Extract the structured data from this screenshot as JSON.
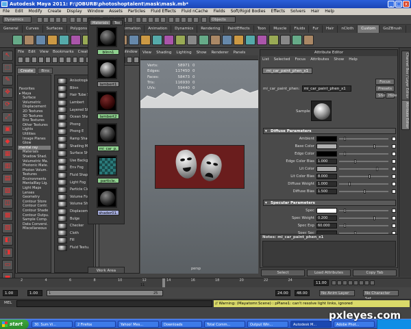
{
  "window": {
    "title": "Autodesk Maya 2011: F:\\JOBURB\\photoshoptalent\\mask\\mask.mb*",
    "min": "_",
    "max": "□",
    "close": "x"
  },
  "menubar": [
    "File",
    "Edit",
    "Modify",
    "Create",
    "Display",
    "Window",
    "Assets",
    "Particles",
    "Fluid Effects",
    "Fluid nCache",
    "Fields",
    "Soft/Rigid Bodies",
    "Effects",
    "Solvers",
    "Hair",
    "Help"
  ],
  "statusline": {
    "mode": "Dynamics",
    "search": "Objects"
  },
  "shelf_tabs": [
    "General",
    "Curves",
    "Surfaces",
    "Polygons",
    "Subdivs",
    "Deformation",
    "Animation",
    "Dynamics",
    "Rendering",
    "PaintEffects",
    "Toon",
    "Muscle",
    "Fluids",
    "Fur",
    "Hair",
    "nCloth",
    "Custom",
    "GoZBrush"
  ],
  "shelf_active": "Custom",
  "hypershade": {
    "menu": [
      "File",
      "Edit",
      "View",
      "Bookmarks",
      "Create",
      "Tabs",
      "Graph",
      "Window"
    ],
    "create_tabs": [
      "Create",
      "Bins"
    ],
    "tree": [
      "Favorites",
      "▸ Maya",
      "Surface",
      "Volumetric",
      "Displacement",
      "2D Textures",
      "3D Textures",
      "Env Textures",
      "Other Textures",
      "Lights",
      "Utilities",
      "Image Planes",
      "Glow",
      "mental ray",
      "Materials",
      "Shadow Shad.",
      "Volumetric Ma.",
      "Photonic Mate.",
      "Photon Volum.",
      "Textures",
      "Environments",
      "MentalRay Lig.",
      "Light Maps",
      "Lenses",
      "Geometry",
      "Contour Store",
      "Contour Contr.",
      "Contour Shade",
      "Contour Outpu.",
      "Sample Comp.",
      "Data Conversi.",
      "Miscellaneous"
    ],
    "tree_selected": "mental ray",
    "nodes": [
      "Anisotropic",
      "Blinn",
      "Hair Tube S.",
      "Lambert",
      "Layered Sha.",
      "Ocean Shad.",
      "Phong",
      "Phong E",
      "Ramp Shad.",
      "Shading Ma.",
      "Surface Sh.",
      "Use Backgr.",
      "Env Fog",
      "Fluid Shap.",
      "Light Fog",
      "Particle Clo.",
      "Volume Fog",
      "Volume Sha.",
      "Displaceme.",
      "Bulge",
      "Checker",
      "Cloth",
      "Fill",
      "Fluid Textu."
    ],
    "material_tabs": [
      "Materials",
      "Tex"
    ],
    "swatches": [
      {
        "label": "blinn1",
        "kind": "dark"
      },
      {
        "label": "lambert1",
        "kind": "gray"
      },
      {
        "label": "lambert2",
        "kind": "red"
      },
      {
        "label": "mi_car_p.",
        "kind": "dark"
      },
      {
        "label": "particle.",
        "kind": "check"
      },
      {
        "label": "shader01.",
        "kind": "dark"
      }
    ],
    "work_area": "Work Area"
  },
  "viewport": {
    "menu": [
      "View",
      "Shading",
      "Lighting",
      "Show",
      "Renderer",
      "Panels"
    ],
    "hud_labels": [
      "Verts:",
      "Edges:",
      "Faces:",
      "Tris:",
      "UVs:"
    ],
    "hud_values": [
      "58971",
      "117450",
      "58473",
      "116930",
      "59440"
    ],
    "hud_values2": [
      "0",
      "0",
      "0",
      "0",
      "0"
    ],
    "camera": "persp"
  },
  "attribute_editor": {
    "title": "Attribute Editor",
    "menu": [
      "List",
      "Selected",
      "Focus",
      "Attributes",
      "Show",
      "Help"
    ],
    "node_tab": "mi_car_paint_phen_x1",
    "node_label": "mi_car_paint_phen:",
    "node_name": "mi_car_paint_phen_x1",
    "buttons": [
      "Focus",
      "Presets",
      "Show",
      "Hide"
    ],
    "sample_label": "Sample",
    "sections": [
      {
        "title": "Diffuse Parameters",
        "rows": [
          {
            "label": "Ambient",
            "type": "color",
            "color": "#000000"
          },
          {
            "label": "Base Color",
            "type": "color",
            "color": "#b0b0b0"
          },
          {
            "label": "Edge Color",
            "type": "color",
            "color": "#000000"
          },
          {
            "label": "Edge Color Bias",
            "type": "value",
            "value": "1.000"
          },
          {
            "label": "Lit Color",
            "type": "color",
            "color": "#a8a8a8"
          },
          {
            "label": "Lit Color Bias",
            "type": "value",
            "value": "8.000"
          },
          {
            "label": "Diffuse Weight",
            "type": "value",
            "value": "1.000"
          },
          {
            "label": "Diffuse Bias",
            "type": "value",
            "value": "1.500"
          }
        ]
      },
      {
        "title": "Specular Parameters",
        "rows": [
          {
            "label": "Spec",
            "type": "color",
            "color": "#ffffff"
          },
          {
            "label": "Spec Weight",
            "type": "value",
            "value": "0.200"
          },
          {
            "label": "Spec Exp",
            "type": "value",
            "value": "60.000"
          },
          {
            "label": "Spec Sec",
            "type": "value",
            "value": ""
          }
        ]
      }
    ],
    "notes_label": "Notes: mi_car_paint_phen_x1",
    "bottom_buttons": [
      "Select",
      "Load Attributes",
      "Copy Tab"
    ]
  },
  "right_strip": [
    "Channel Box / Layer Editor",
    "Attribute Editor"
  ],
  "timeslider": {
    "ticks": [
      "2",
      "4",
      "6",
      "8",
      "10",
      "12",
      "14",
      "16",
      "18",
      "20",
      "22",
      "24"
    ],
    "current": "11.00",
    "frame_mark": "11"
  },
  "range": {
    "start1": "1.00",
    "start2": "1.00",
    "mid": "1",
    "end_mark": "25",
    "end1": "24.00",
    "end2": "48.00",
    "anim_layer": "No Anim Layer",
    "char_set": "No Character Set"
  },
  "cmd": {
    "label": "MEL",
    "warning": "// Warning: (Mayatomr.Scene) : pPlane1: can't resolve light links, ignored"
  },
  "taskbar": {
    "start": "start",
    "tasks": [
      "30. Sum Vi...",
      "2 Firefox",
      "Yahoo! Mes...",
      "Downloads",
      "Total Comm...",
      "Output Win...",
      "Autodesk M...",
      "Adobe Phot..."
    ],
    "active_task": 6
  },
  "watermark": "pxleyes.com"
}
